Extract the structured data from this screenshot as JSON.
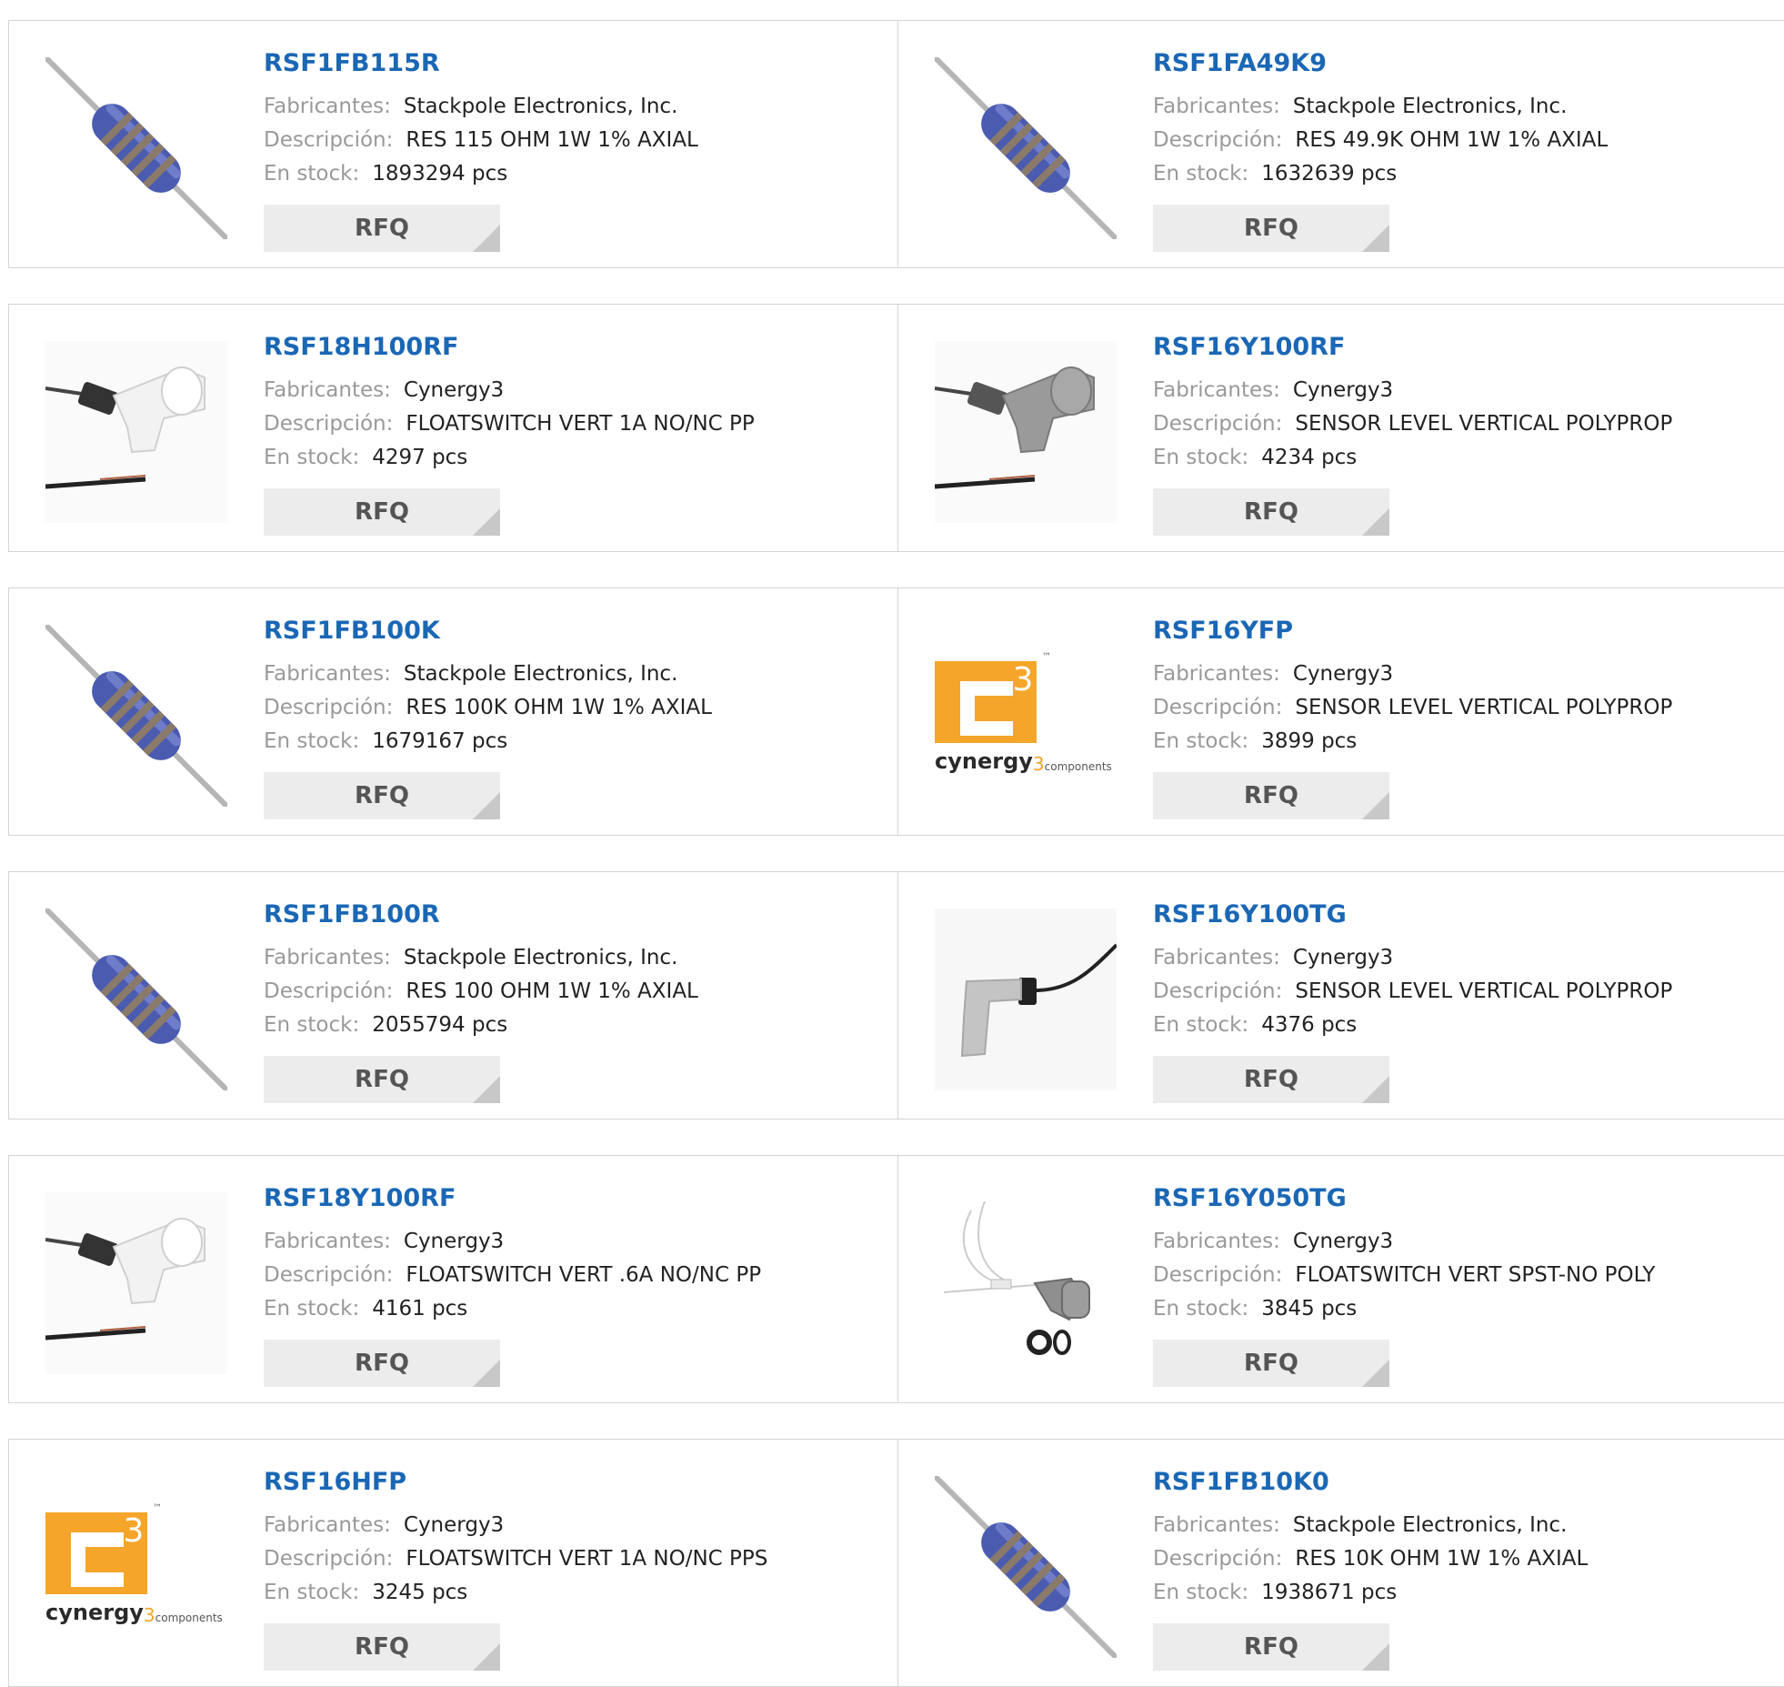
{
  "labels": {
    "manufacturer": "Fabricantes:",
    "description": "Descripción:",
    "stock": "En stock:",
    "rfq": "RFQ"
  },
  "products": [
    {
      "part": "RSF1FB115R",
      "manufacturer": "Stackpole Electronics, Inc.",
      "description": "RES 115 OHM 1W 1% AXIAL",
      "stock": "1893294 pcs",
      "image": "resistor"
    },
    {
      "part": "RSF1FA49K9",
      "manufacturer": "Stackpole Electronics, Inc.",
      "description": "RES 49.9K OHM 1W 1% AXIAL",
      "stock": "1632639 pcs",
      "image": "resistor"
    },
    {
      "part": "RSF18H100RF",
      "manufacturer": "Cynergy3",
      "description": "FLOATSWITCH VERT 1A NO/NC PP",
      "stock": "4297 pcs",
      "image": "float-switch-white"
    },
    {
      "part": "RSF16Y100RF",
      "manufacturer": "Cynergy3",
      "description": "SENSOR LEVEL VERTICAL POLYPROP",
      "stock": "4234 pcs",
      "image": "float-switch-gray"
    },
    {
      "part": "RSF1FB100K",
      "manufacturer": "Stackpole Electronics, Inc.",
      "description": "RES 100K OHM 1W 1% AXIAL",
      "stock": "1679167 pcs",
      "image": "resistor"
    },
    {
      "part": "RSF16YFP",
      "manufacturer": "Cynergy3",
      "description": "SENSOR LEVEL VERTICAL POLYPROP",
      "stock": "3899 pcs",
      "image": "cynergy3-logo",
      "logo_text": "cynergy",
      "logo_sup": "3",
      "logo_sub": "components",
      "logo_tm": "™"
    },
    {
      "part": "RSF1FB100R",
      "manufacturer": "Stackpole Electronics, Inc.",
      "description": "RES 100 OHM 1W 1% AXIAL",
      "stock": "2055794 pcs",
      "image": "resistor"
    },
    {
      "part": "RSF16Y100TG",
      "manufacturer": "Cynergy3",
      "description": "SENSOR LEVEL VERTICAL POLYPROP",
      "stock": "4376 pcs",
      "image": "float-sensor-cable"
    },
    {
      "part": "RSF18Y100RF",
      "manufacturer": "Cynergy3",
      "description": "FLOATSWITCH VERT .6A NO/NC PP",
      "stock": "4161 pcs",
      "image": "float-switch-white"
    },
    {
      "part": "RSF16Y050TG",
      "manufacturer": "Cynergy3",
      "description": "FLOATSWITCH VERT SPST-NO POLY",
      "stock": "3845 pcs",
      "image": "float-switch-kit"
    },
    {
      "part": "RSF16HFP",
      "manufacturer": "Cynergy3",
      "description": "FLOATSWITCH VERT 1A NO/NC PPS",
      "stock": "3245 pcs",
      "image": "cynergy3-logo",
      "logo_text": "cynergy",
      "logo_sup": "3",
      "logo_sub": "components",
      "logo_tm": "™"
    },
    {
      "part": "RSF1FB10K0",
      "manufacturer": "Stackpole Electronics, Inc.",
      "description": "RES 10K OHM 1W 1% AXIAL",
      "stock": "1938671 pcs",
      "image": "resistor"
    }
  ]
}
